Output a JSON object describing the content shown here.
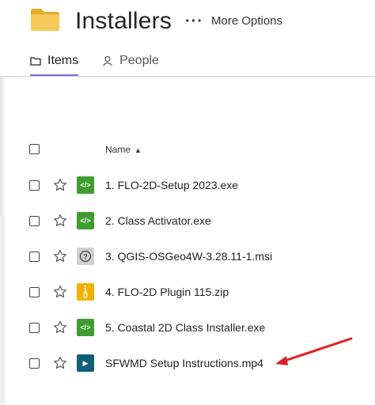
{
  "header": {
    "title": "Installers",
    "more_options_label": "More Options",
    "folder_color": "#f5c048"
  },
  "tabs": [
    {
      "label": "Items",
      "active": true,
      "icon": "folder-outline-icon"
    },
    {
      "label": "People",
      "active": false,
      "icon": "person-icon"
    }
  ],
  "list": {
    "name_column": "Name",
    "sort": "ascending",
    "files": [
      {
        "name": "1. FLO-2D-Setup 2023.exe",
        "type": "exe",
        "icon_glyph": "</>"
      },
      {
        "name": "2. Class Activator.exe",
        "type": "exe",
        "icon_glyph": "</>"
      },
      {
        "name": "3. QGIS-OSGeo4W-3.28.11-1.msi",
        "type": "msi",
        "icon_glyph": "?"
      },
      {
        "name": "4. FLO-2D Plugin 115.zip",
        "type": "zip",
        "icon_glyph": ""
      },
      {
        "name": "5. Coastal 2D Class Installer.exe",
        "type": "exe",
        "icon_glyph": "</>"
      },
      {
        "name": "SFWMD Setup Instructions.mp4",
        "type": "mp4",
        "icon_glyph": "▶"
      }
    ]
  },
  "annotation": {
    "arrow_color": "#e0201d"
  }
}
